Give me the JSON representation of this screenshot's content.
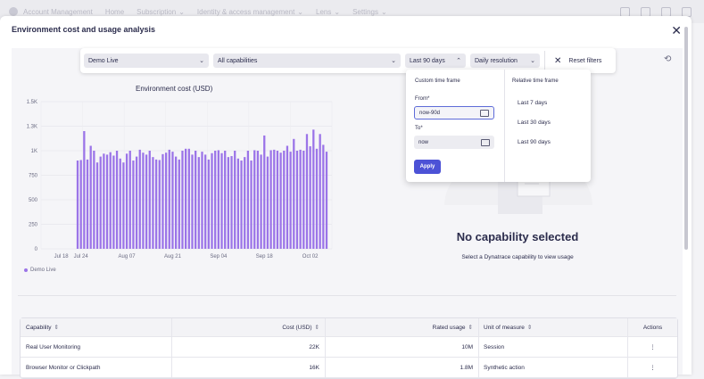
{
  "topnav": {
    "app": "Account Management",
    "items": [
      "Home",
      "Subscription",
      "Identity & access management",
      "Lens",
      "Settings"
    ]
  },
  "dialog": {
    "title": "Environment cost and usage analysis"
  },
  "filters": {
    "environment": "Demo Live",
    "capabilities": "All capabilities",
    "timeframe": "Last 90 days",
    "resolution": "Daily resolution",
    "reset": "Reset filters"
  },
  "timeframe_menu": {
    "custom_title": "Custom time frame",
    "from_label": "From*",
    "from_value": "now-90d",
    "to_label": "To*",
    "to_value": "now",
    "apply": "Apply",
    "relative_title": "Relative time frame",
    "relative_options": [
      "Last 7 days",
      "Last 30 days",
      "Last 90 days"
    ]
  },
  "chart_data": {
    "type": "bar",
    "title": "Environment cost (USD)",
    "ytick_labels": [
      "0",
      "250",
      "500",
      "750",
      "1K",
      "1.3K",
      "1.5K"
    ],
    "ylim": [
      0,
      1500
    ],
    "yticks": [
      0,
      250,
      500,
      750,
      1000,
      1250,
      1500
    ],
    "xtick_labels": [
      "Jul 18",
      "Jul 24",
      "Aug 07",
      "Aug 21",
      "Sep 04",
      "Sep 18",
      "Oct 02"
    ],
    "xtick_index": [
      -5,
      1,
      15,
      29,
      43,
      57,
      71
    ],
    "legend": [
      "Demo Live"
    ],
    "color": "#9b74e8",
    "values": [
      900,
      905,
      1200,
      910,
      1050,
      1000,
      880,
      940,
      970,
      960,
      985,
      950,
      1000,
      920,
      880,
      970,
      1000,
      900,
      940,
      1010,
      980,
      960,
      1000,
      935,
      910,
      905,
      965,
      980,
      1010,
      990,
      940,
      910,
      1000,
      1020,
      1020,
      960,
      1000,
      935,
      990,
      960,
      910,
      975,
      1000,
      1005,
      975,
      1000,
      935,
      945,
      1000,
      920,
      900,
      935,
      1000,
      900,
      1005,
      1000,
      960,
      1155,
      940,
      1005,
      1010,
      1000,
      980,
      1000,
      1050,
      990,
      1120,
      1000,
      1010,
      1000,
      1170,
      1045,
      1215,
      1020,
      1170,
      1060,
      990
    ]
  },
  "empty_state": {
    "title": "No capability selected",
    "subtitle": "Select a Dynatrace capability to view usage"
  },
  "table": {
    "headers": [
      "Capability",
      "Cost (USD)",
      "Rated usage",
      "Unit of measure",
      "Actions"
    ],
    "rows": [
      {
        "capability": "Real User Monitoring",
        "cost": "22K",
        "usage": "10M",
        "unit": "Session"
      },
      {
        "capability": "Browser Monitor or Clickpath",
        "cost": "16K",
        "usage": "1.8M",
        "unit": "Synthetic action"
      }
    ]
  }
}
